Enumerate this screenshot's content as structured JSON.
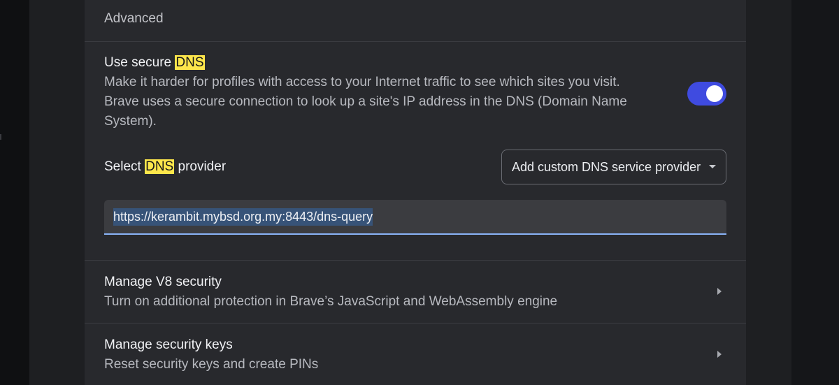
{
  "section": {
    "header": "Advanced"
  },
  "secure_dns": {
    "title_prefix": "Use secure ",
    "title_highlight": "DNS",
    "description_line1": "Make it harder for profiles with access to your Internet traffic to see which sites you visit.",
    "description_line2": "Brave uses a secure connection to look up a site's IP address in the DNS (Domain Name",
    "description_line3": "System).",
    "enabled": true,
    "accent_color": "#3f4be0",
    "highlight_color": "#fde64b"
  },
  "dns_provider": {
    "label_prefix": "Select ",
    "label_highlight": "DNS",
    "label_suffix": " provider",
    "selected_option": "Add custom DNS service provider",
    "custom_url": "https://kerambit.mybsd.org.my:8443/dns-query"
  },
  "v8_security": {
    "title": "Manage V8 security",
    "description": "Turn on additional protection in Brave’s JavaScript and WebAssembly engine"
  },
  "security_keys": {
    "title": "Manage security keys",
    "description": "Reset security keys and create PINs"
  }
}
